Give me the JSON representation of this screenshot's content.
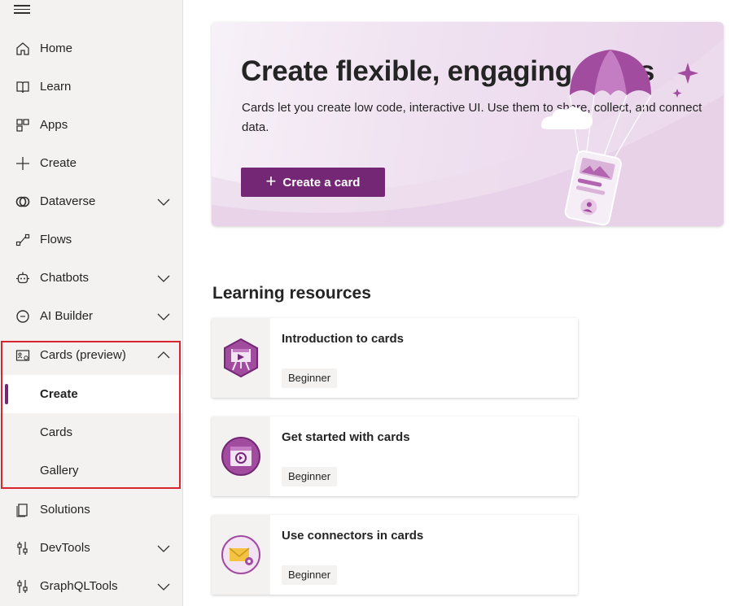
{
  "sidebar": {
    "menu_icon": "hamburger-icon",
    "items": [
      {
        "label": "Home",
        "icon": "home-icon"
      },
      {
        "label": "Learn",
        "icon": "book-icon"
      },
      {
        "label": "Apps",
        "icon": "apps-icon"
      },
      {
        "label": "Create",
        "icon": "plus-icon"
      },
      {
        "label": "Dataverse",
        "icon": "dataverse-icon",
        "expandable": true
      },
      {
        "label": "Flows",
        "icon": "flows-icon"
      },
      {
        "label": "Chatbots",
        "icon": "chatbot-icon",
        "expandable": true
      },
      {
        "label": "AI Builder",
        "icon": "ai-builder-icon",
        "expandable": true
      },
      {
        "label": "Cards (preview)",
        "icon": "cards-icon",
        "expanded": true
      },
      {
        "label": "Solutions",
        "icon": "solutions-icon"
      },
      {
        "label": "DevTools",
        "icon": "devtools-icon",
        "expandable": true
      },
      {
        "label": "GraphQLTools",
        "icon": "graphqltools-icon",
        "expandable": true
      }
    ],
    "cards_sub": [
      {
        "label": "Create",
        "active": true
      },
      {
        "label": "Cards"
      },
      {
        "label": "Gallery"
      }
    ]
  },
  "hero": {
    "title": "Create flexible, engaging cards",
    "description": "Cards let you create low code, interactive UI. Use them to share, collect, and connect data.",
    "button_label": "Create a card",
    "accent": "#742774"
  },
  "learning": {
    "title": "Learning resources",
    "items": [
      {
        "title": "Introduction to cards",
        "badge": "Beginner",
        "icon": "presentation-icon"
      },
      {
        "title": "Get started with cards",
        "badge": "Beginner",
        "icon": "card-sync-icon"
      },
      {
        "title": "Use connectors in cards",
        "badge": "Beginner",
        "icon": "mail-connector-icon"
      }
    ]
  },
  "colors": {
    "accent": "#742774",
    "highlight": "#d7262f",
    "sidebar_bg": "#f3f2f1"
  }
}
